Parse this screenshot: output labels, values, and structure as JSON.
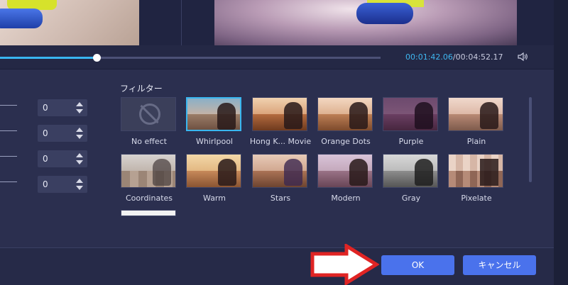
{
  "playback": {
    "current_time": "00:01:42.06",
    "separator": "/",
    "total_time": "00:04:52.17",
    "progress_fraction": 0.253,
    "accent_color": "#39b6f0"
  },
  "adjustments": {
    "values": [
      "0",
      "0",
      "0",
      "0"
    ]
  },
  "filters": {
    "title": "フィルター",
    "selected": "Whirlpool",
    "items": [
      {
        "label": "No effect"
      },
      {
        "label": "Whirlpool"
      },
      {
        "label": "Hong K... Movie"
      },
      {
        "label": "Orange Dots"
      },
      {
        "label": "Purple"
      },
      {
        "label": "Plain"
      },
      {
        "label": "Coordinates"
      },
      {
        "label": "Warm"
      },
      {
        "label": "Stars"
      },
      {
        "label": "Modern"
      },
      {
        "label": "Gray"
      },
      {
        "label": "Pixelate"
      }
    ]
  },
  "buttons": {
    "ok": "OK",
    "cancel": "キャンセル",
    "primary_color": "#4a72ec"
  },
  "icons": {
    "volume": "speaker-icon",
    "no_effect": "no-effect-icon",
    "pointer": "red-arrow-annotation"
  }
}
